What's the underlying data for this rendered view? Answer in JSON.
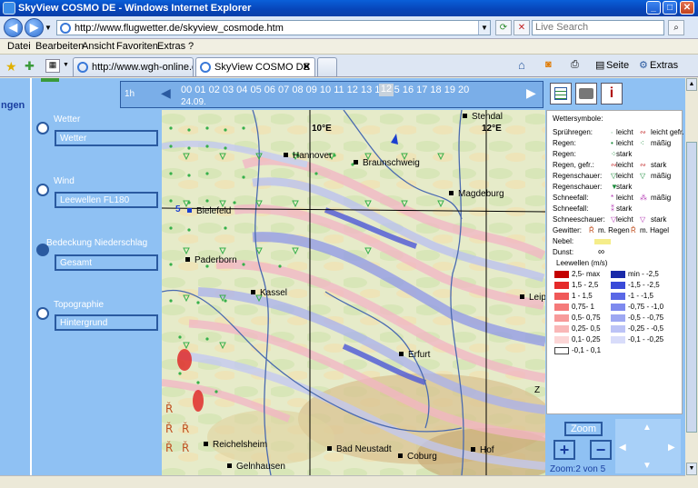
{
  "window": {
    "title": "SkyView COSMO DE - Windows Internet Explorer",
    "minimize": "_",
    "maximize": "□",
    "close": "✕"
  },
  "address": {
    "url": "http://www.flugwetter.de/skyview_cosmode.htm",
    "search_placeholder": "Live Search"
  },
  "menu": [
    "Datei",
    "Bearbeiten",
    "Ansicht",
    "Favoriten",
    "Extras",
    "?"
  ],
  "tabs": [
    {
      "label": "http://www.wgh-online.de/w..."
    },
    {
      "label": "SkyView COSMO DE"
    }
  ],
  "commandbar": {
    "page": "Seite",
    "tools": "Extras"
  },
  "sidebar": {
    "cut_text": "ngen",
    "controls": [
      {
        "label": "Wetter",
        "value": "Wetter"
      },
      {
        "label": "Wind",
        "value": "Leewellen FL180"
      },
      {
        "label": "Bedeckung  Niederschlag",
        "value": "Gesamt"
      },
      {
        "label": "Topographie",
        "value": "Hintergrund"
      }
    ]
  },
  "hours": {
    "step": "1h",
    "hours_text": "00  01  02  03  04  05  06  07  08  09  10  11  12  13  14  15  16  17  18  19  20",
    "date": "24.09.",
    "selected": "12"
  },
  "map": {
    "meridians": [
      "10°E",
      "12°E"
    ],
    "latitude_cut": "5",
    "cities": [
      "Stendal",
      "Hannover",
      "Braunschweig",
      "Magdeburg",
      "Bielefeld",
      "Paderborn",
      "Kassel",
      "Leip",
      "Erfurt",
      "Reichelsheim",
      "Bad Neustadt",
      "Coburg",
      "Hof",
      "Gelnhausen",
      "Z"
    ]
  },
  "legend": {
    "weather_title": "Wettersymbole:",
    "weather_rows": [
      {
        "label": "Sprühregen:",
        "v1": "leicht",
        "v2": "leicht gefr."
      },
      {
        "label": "Regen:",
        "v1": "leicht",
        "v2": "mäßig"
      },
      {
        "label": "Regen:",
        "v1": "stark",
        "v2": ""
      },
      {
        "label": "Regen, gefr.:",
        "v1": "leicht",
        "v2": "stark"
      },
      {
        "label": "Regenschauer:",
        "v1": "leicht",
        "v2": "mäßig"
      },
      {
        "label": "Regenschauer:",
        "v1": "stark",
        "v2": ""
      },
      {
        "label": "Schneefall:",
        "v1": "leicht",
        "v2": "mäßig"
      },
      {
        "label": "Schneefall:",
        "v1": "stark",
        "v2": ""
      },
      {
        "label": "Schneeschauer:",
        "v1": "leicht",
        "v2": "stark"
      },
      {
        "label": "Gewitter:",
        "v1": "m. Regen",
        "v2": "m. Hagel"
      },
      {
        "label": "Nebel:",
        "v1": "",
        "v2": ""
      },
      {
        "label": "Dunst:",
        "v1": "",
        "v2": ""
      }
    ],
    "lee_title": "Leewellen (m/s)",
    "lee_rows": [
      {
        "pos": "2,5- max",
        "neg": "min - -2,5",
        "pc": "#c40000",
        "nc": "#1a2aa8"
      },
      {
        "pos": "1,5 - 2,5",
        "neg": "-1,5 - -2,5",
        "pc": "#e52a2a",
        "nc": "#3a4ad8"
      },
      {
        "pos": "1 - 1,5",
        "neg": "-1 - -1,5",
        "pc": "#f05858",
        "nc": "#5a68e6"
      },
      {
        "pos": "0,75- 1",
        "neg": "-0,75 - -1,0",
        "pc": "#f57a7a",
        "nc": "#7e8aee"
      },
      {
        "pos": "0,5- 0,75",
        "neg": "-0,5 - -0,75",
        "pc": "#f79a9a",
        "nc": "#9ea8f2"
      },
      {
        "pos": "0,25- 0,5",
        "neg": "-0,25 - -0,5",
        "pc": "#f9b8b8",
        "nc": "#bcc3f6"
      },
      {
        "pos": "0,1- 0,25",
        "neg": "-0,1 - -0,25",
        "pc": "#fcd6d6",
        "nc": "#d8dcfa"
      },
      {
        "pos": "-0,1 - 0,1",
        "neg": "",
        "pc": "#ffffff",
        "nc": ""
      }
    ]
  },
  "zoom": {
    "title": "Zoom",
    "plus": "+",
    "minus": "−",
    "level": "Zoom:2 von 5"
  }
}
